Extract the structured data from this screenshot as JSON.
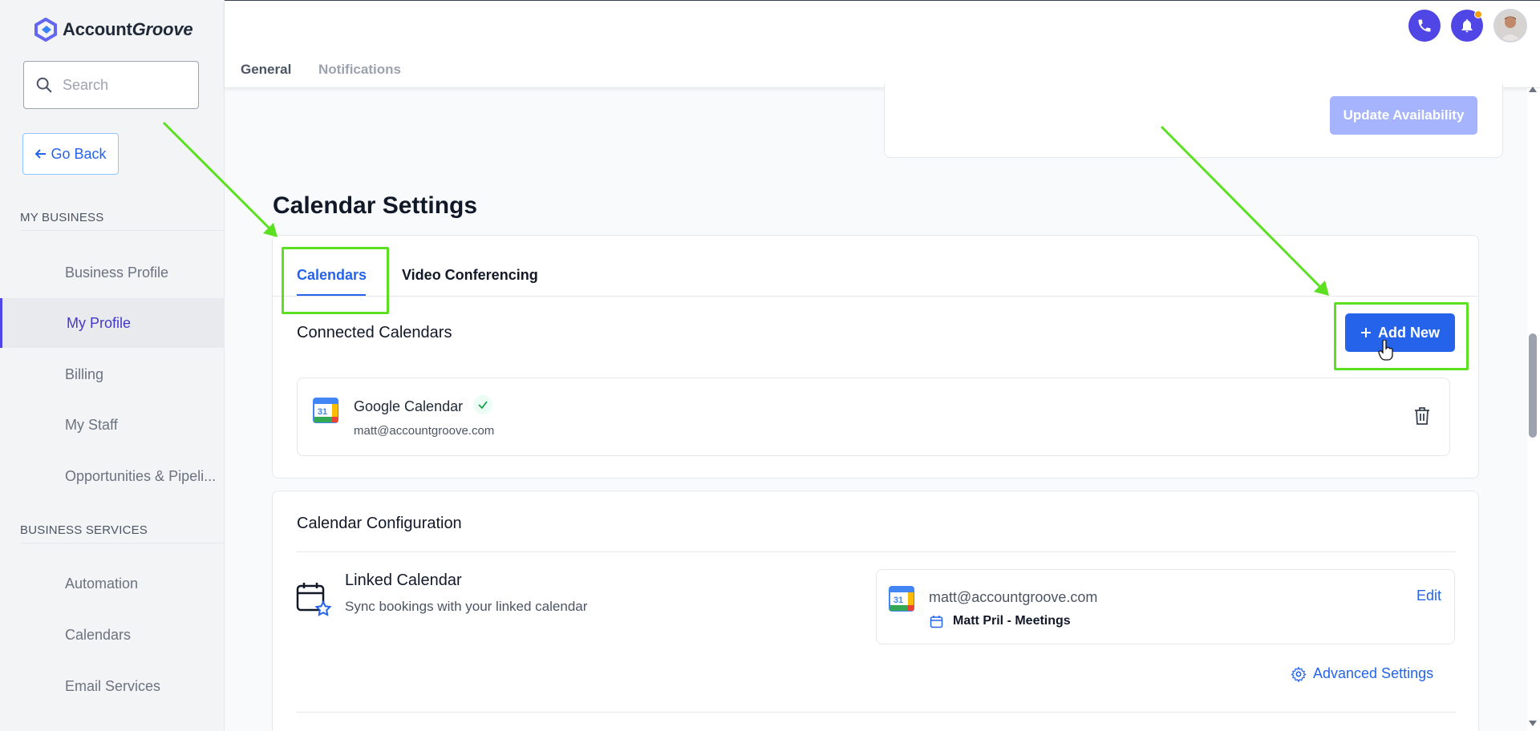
{
  "sidebar": {
    "logo": {
      "brand_a": "Account",
      "brand_b": "Groove"
    },
    "search": {
      "placeholder": "Search"
    },
    "go_back_label": "Go Back",
    "sections": [
      {
        "title": "MY BUSINESS",
        "items": [
          "Business Profile",
          "My Profile",
          "Billing",
          "My Staff",
          "Opportunities & Pipeli..."
        ]
      },
      {
        "title": "BUSINESS SERVICES",
        "items": [
          "Automation",
          "Calendars",
          "Email Services"
        ]
      }
    ],
    "active_item": "My Profile"
  },
  "header": {
    "tabs": [
      "General",
      "Notifications"
    ],
    "active_tab": "General",
    "notification_dot_color": "#f59e0b"
  },
  "availability": {
    "update_button": "Update Availability"
  },
  "calendar_settings": {
    "title": "Calendar Settings",
    "tabs": [
      "Calendars",
      "Video Conferencing"
    ],
    "active_tab": "Calendars",
    "connected": {
      "heading": "Connected Calendars",
      "add_button": "Add New",
      "items": [
        {
          "name": "Google Calendar",
          "email": "matt@accountgroove.com",
          "icon_day": "31",
          "status": "connected"
        }
      ]
    },
    "configuration": {
      "heading": "Calendar Configuration",
      "linked": {
        "title": "Linked Calendar",
        "description": "Sync bookings with your linked calendar",
        "email": "matt@accountgroove.com",
        "calendar_name": "Matt Pril - Meetings",
        "edit_label": "Edit",
        "icon_day": "31"
      },
      "advanced_settings_label": "Advanced Settings"
    }
  },
  "colors": {
    "primary": "#2563eb",
    "accent": "#4f46e5",
    "annotation": "#5ae021"
  }
}
